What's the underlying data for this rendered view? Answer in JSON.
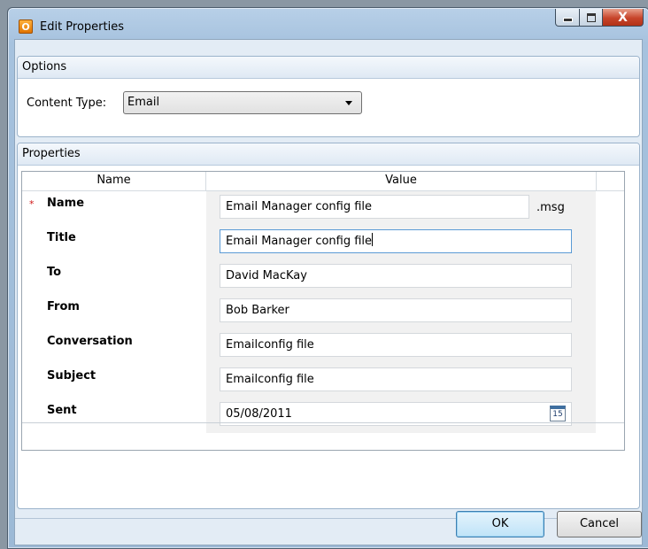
{
  "window": {
    "title": "Edit Properties",
    "app_icon_letter": "O",
    "close_glyph": "X"
  },
  "options": {
    "header": "Options",
    "content_type_label": "Content Type:",
    "content_type_value": "Email"
  },
  "properties": {
    "header": "Properties",
    "columns": {
      "name": "Name",
      "value": "Value"
    },
    "required_marker": "*",
    "rows": [
      {
        "label": "Name",
        "value": "Email Manager config file",
        "suffix": ".msg",
        "required": true
      },
      {
        "label": "Title",
        "value": "Email Manager config file",
        "focused": true
      },
      {
        "label": "To",
        "value": "David MacKay"
      },
      {
        "label": "From",
        "value": "Bob Barker"
      },
      {
        "label": "Conversation",
        "value": "Emailconfig file"
      },
      {
        "label": "Subject",
        "value": "Emailconfig file"
      },
      {
        "label": "Sent",
        "value": "05/08/2011",
        "calendar_day": "15"
      }
    ]
  },
  "buttons": {
    "ok": "OK",
    "cancel": "Cancel"
  },
  "colors": {
    "accent": "#3c7fb1",
    "required": "#d01515",
    "close_button": "#c7442a"
  }
}
